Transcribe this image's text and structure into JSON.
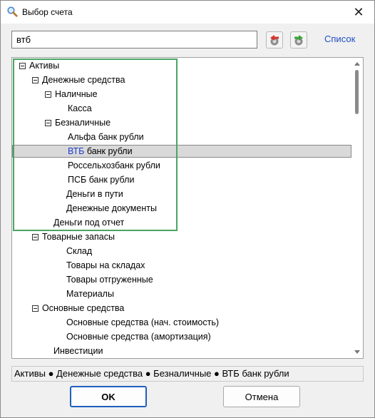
{
  "window": {
    "title": "Выбор счета",
    "close_glyph": "✕",
    "icon": "magnifier-icon"
  },
  "toolbar": {
    "search_value": "втб",
    "back_icon": "back-arrow-icon",
    "forward_icon": "forward-arrow-icon",
    "list_label": "Список"
  },
  "tree": {
    "items": [
      {
        "label": "Активы",
        "level": 0,
        "toggle": true
      },
      {
        "label": "Денежные средства",
        "level": 1,
        "toggle": true
      },
      {
        "label": "Наличные",
        "level": 2,
        "toggle": true
      },
      {
        "label": "Касса",
        "level": 3,
        "toggle": false
      },
      {
        "label": "Безналичные",
        "level": 2,
        "toggle": true
      },
      {
        "label": "Альфа банк рубли",
        "level": 3,
        "toggle": false
      },
      {
        "label_hl": "ВТБ",
        "label_rest": " банк рубли",
        "level": 3,
        "toggle": false,
        "selected": true
      },
      {
        "label": "Россельхозбанк рубли",
        "level": 3,
        "toggle": false
      },
      {
        "label": "ПСБ банк рубли",
        "level": 3,
        "toggle": false
      },
      {
        "label": "Деньги в пути",
        "level": 2,
        "toggle": false
      },
      {
        "label": "Денежные документы",
        "level": 2,
        "toggle": false
      },
      {
        "label": "Деньги под отчет",
        "level": 1,
        "toggle": false
      },
      {
        "label": "Товарные запасы",
        "level": 1,
        "toggle": true
      },
      {
        "label": "Склад",
        "level": 2,
        "toggle": false
      },
      {
        "label": "Товары на складах",
        "level": 2,
        "toggle": false
      },
      {
        "label": "Товары отгруженные",
        "level": 2,
        "toggle": false
      },
      {
        "label": "Материалы",
        "level": 2,
        "toggle": false
      },
      {
        "label": "Основные средства",
        "level": 1,
        "toggle": true
      },
      {
        "label": "Основные средства (нач. стоимость)",
        "level": 2,
        "toggle": false
      },
      {
        "label": "Основные средства (амортизация)",
        "level": 2,
        "toggle": false
      },
      {
        "label": "Инвестиции",
        "level": 1,
        "toggle": false
      }
    ]
  },
  "path_bar": {
    "text": "Активы ● Денежные средства ● Безналичные ● ВТБ банк рубли"
  },
  "buttons": {
    "ok": "OK",
    "cancel": "Отмена"
  },
  "colors": {
    "accent": "#1f5fbf",
    "highlight_frame": "#4aa564",
    "match_text": "#1f3fcf"
  }
}
